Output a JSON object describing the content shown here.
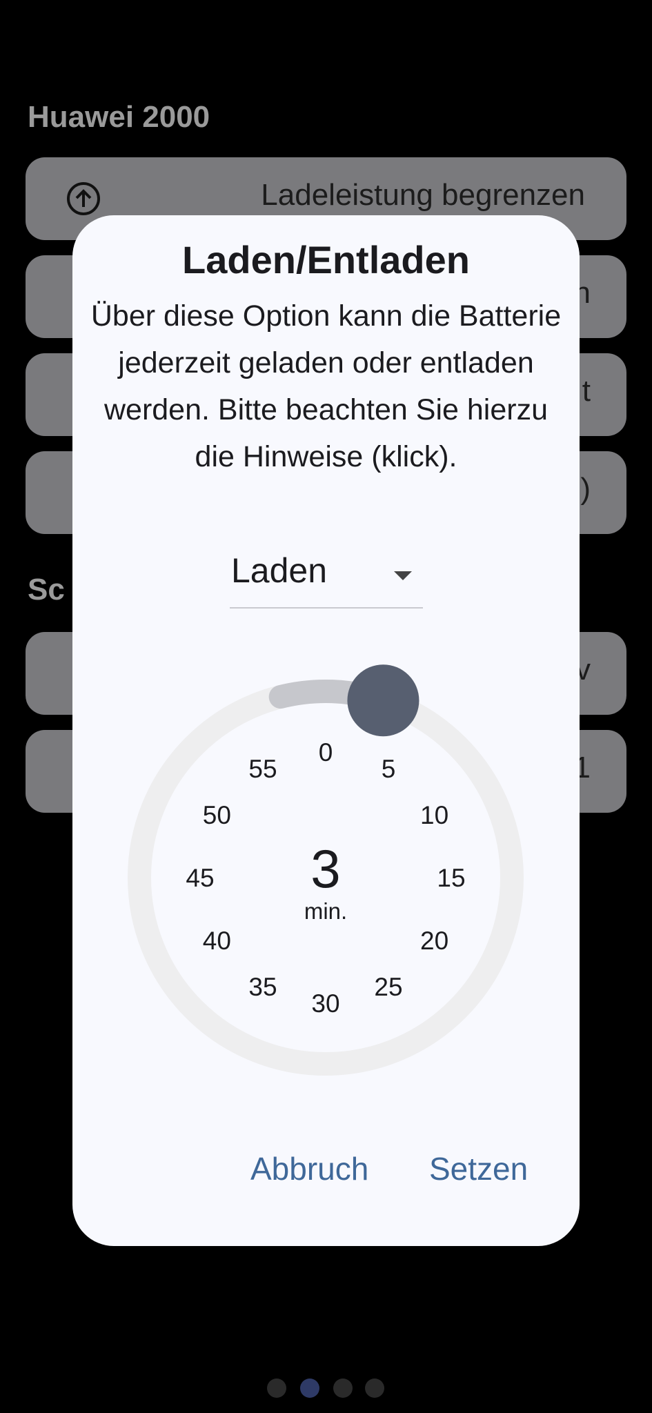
{
  "background": {
    "device_title": "Huawei 2000",
    "section_title_partial": "Sc",
    "cards": [
      {
        "label": "Ladeleistung begrenzen",
        "icon": "arrow-up-circle-icon"
      },
      {
        "label": "n",
        "icon": "circle-icon"
      },
      {
        "label": "t",
        "icon": "chevron-icon"
      },
      {
        "label": ")",
        "icon": ""
      },
      {
        "label": "v",
        "icon": "status-circle-icon"
      },
      {
        "label": "1",
        "icon": "circle-icon"
      }
    ]
  },
  "dialog": {
    "title": "Laden/Entladen",
    "body": "Über diese Option kann die Batterie jederzeit geladen oder entladen werden. Bitte beachten Sie hierzu die Hinweise (klick).",
    "mode_dropdown": {
      "selected": "Laden"
    },
    "timer": {
      "value": "3",
      "unit": "min.",
      "ticks": [
        "0",
        "5",
        "10",
        "15",
        "20",
        "25",
        "30",
        "35",
        "40",
        "45",
        "50",
        "55"
      ],
      "progress_fraction": 0.05
    },
    "buttons": {
      "cancel": "Abbruch",
      "confirm": "Setzen"
    }
  },
  "page_indicator": {
    "count": 4,
    "active": 1
  },
  "colors": {
    "accent": "#3f6899",
    "knob": "#575f70",
    "dialog_bg": "#f8f9fe",
    "dot_active": "#2e3a66"
  }
}
